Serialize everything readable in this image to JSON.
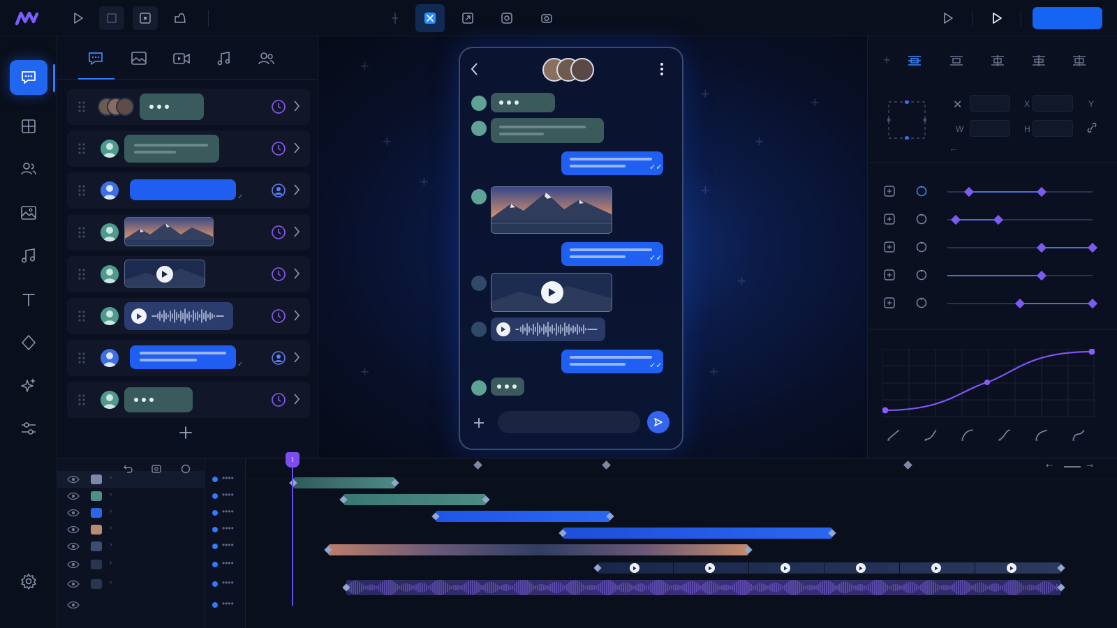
{
  "app": {
    "logo": "M"
  },
  "toolbar": {
    "left_tools": [
      "play-icon",
      "stop-icon",
      "frame-icon",
      "export-icon"
    ],
    "center_tools": [
      "add-icon",
      "transform-icon",
      "resize-icon",
      "record-icon",
      "camera-icon"
    ],
    "active_tool": "transform-icon",
    "right_tools": [
      "preview-play-icon",
      "play-icon"
    ],
    "publish_label": ""
  },
  "sidebar": {
    "items": [
      {
        "name": "chat-icon",
        "active": true
      },
      {
        "name": "layout-icon",
        "active": false
      },
      {
        "name": "users-icon",
        "active": false
      },
      {
        "name": "image-icon",
        "active": false
      },
      {
        "name": "music-icon",
        "active": false
      },
      {
        "name": "text-icon",
        "active": false
      },
      {
        "name": "shapes-icon",
        "active": false
      },
      {
        "name": "sparkles-icon",
        "active": false
      },
      {
        "name": "adjustments-icon",
        "active": false
      }
    ],
    "footer": "settings-icon"
  },
  "message_panel": {
    "tabs": [
      "chat-icon",
      "image-icon",
      "video-icon",
      "music-icon",
      "contacts-icon"
    ],
    "active_tab": "chat-icon",
    "rows": [
      {
        "type": "typing",
        "sender": "group"
      },
      {
        "type": "text",
        "sender": "contact"
      },
      {
        "type": "text",
        "sender": "me"
      },
      {
        "type": "image",
        "sender": "contact"
      },
      {
        "type": "video",
        "sender": "contact"
      },
      {
        "type": "audio",
        "sender": "contact"
      },
      {
        "type": "text",
        "sender": "me"
      },
      {
        "type": "typing",
        "sender": "contact"
      }
    ],
    "add_button": "+"
  },
  "phone_preview": {
    "back_icon": "chevron-left-icon",
    "menu_icon": "more-vertical-icon",
    "composer_placeholder": "",
    "add_icon": "+",
    "send_icon": "send-icon"
  },
  "inspector": {
    "tools": [
      "align-icon",
      "distribute-h-icon",
      "distribute-v-icon",
      "align-center-icon",
      "align-bottom-icon"
    ],
    "fields": {
      "x_label": "X",
      "y_label": "Y",
      "w_label": "W",
      "h_label": "H",
      "x_value": "",
      "y_value": "",
      "w_value": "",
      "h_value": ""
    },
    "properties": [
      {
        "icon": "move-icon",
        "icon2": "rotate-icon",
        "keyframes": [
          0.15,
          0.65
        ]
      },
      {
        "icon": "scale-icon",
        "icon2": "refresh-icon",
        "keyframes": [
          0.06,
          0.35
        ]
      },
      {
        "icon": "expand-icon",
        "icon2": "circle-icon",
        "keyframes": [
          0.65,
          1.0
        ]
      },
      {
        "icon": "opacity-icon",
        "icon2": "anchor-icon",
        "keyframes": [
          0.65
        ]
      },
      {
        "icon": "blur-icon",
        "icon2": "target-icon",
        "keyframes": [
          0.5,
          1.0
        ]
      }
    ],
    "easing_presets": [
      "linear-icon",
      "ease-in-icon",
      "ease-out-icon",
      "ease-in-out-icon",
      "bounce-icon",
      "elastic-icon"
    ]
  },
  "timeline": {
    "tools": [
      "undo-icon",
      "snapshot-icon",
      "loop-icon"
    ],
    "playhead_label": "I",
    "layers": [
      {
        "thumb": "group-avatar",
        "color": "#7a8aa8"
      },
      {
        "thumb": "text-bubble",
        "color": "#4e8f8a"
      },
      {
        "thumb": "blue-bubble",
        "color": "#2b66e8"
      },
      {
        "thumb": "image",
        "color": "#b98c6f"
      },
      {
        "thumb": "video",
        "color": "#3b4d70"
      },
      {
        "thumb": "play",
        "color": "#2a3550"
      },
      {
        "thumb": "audio",
        "color": "#2a3550"
      },
      {
        "thumb": "empty",
        "color": "#0c1222"
      }
    ],
    "zoom_icons": [
      "zoom-out-icon",
      "zoom-slider",
      "zoom-in-icon"
    ]
  },
  "colors": {
    "accent": "#2166ee",
    "keyframe": "#7c5cf0",
    "teal_bubble": "#3a5b5d",
    "clock": "#8b5cf6"
  }
}
